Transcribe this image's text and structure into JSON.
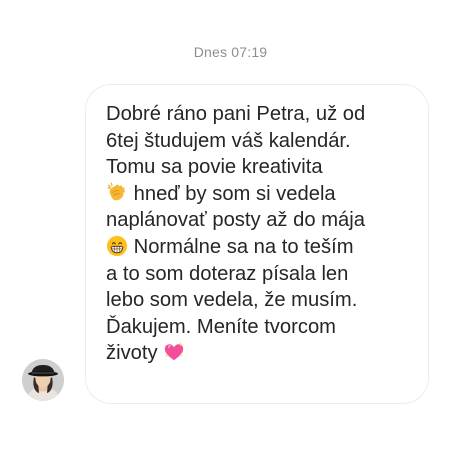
{
  "timestamp": "Dnes 07:19",
  "message": {
    "line1": "Dobré ráno pani Petra, už od",
    "line2": "6tej študujem váš kalendár.",
    "line3": "Tomu sa povie kreativita",
    "line4": "hneď by som si vedela",
    "line5": "naplánovať posty až do mája",
    "line6": "Normálne sa na to teším",
    "line7": "a to som doteraz písala len",
    "line8": "lebo som vedela, že musím.",
    "line9": "Ďakujem. Meníte tvorcom",
    "line10": "životy"
  },
  "icons": {
    "clapping": "clapping-hands-icon",
    "grin": "grinning-face-icon",
    "heart": "sparkling-heart-icon",
    "avatar": "profile-avatar"
  },
  "colors": {
    "text": "#262626",
    "timestamp": "#8e8e8e",
    "bubble_border": "#ececec"
  }
}
